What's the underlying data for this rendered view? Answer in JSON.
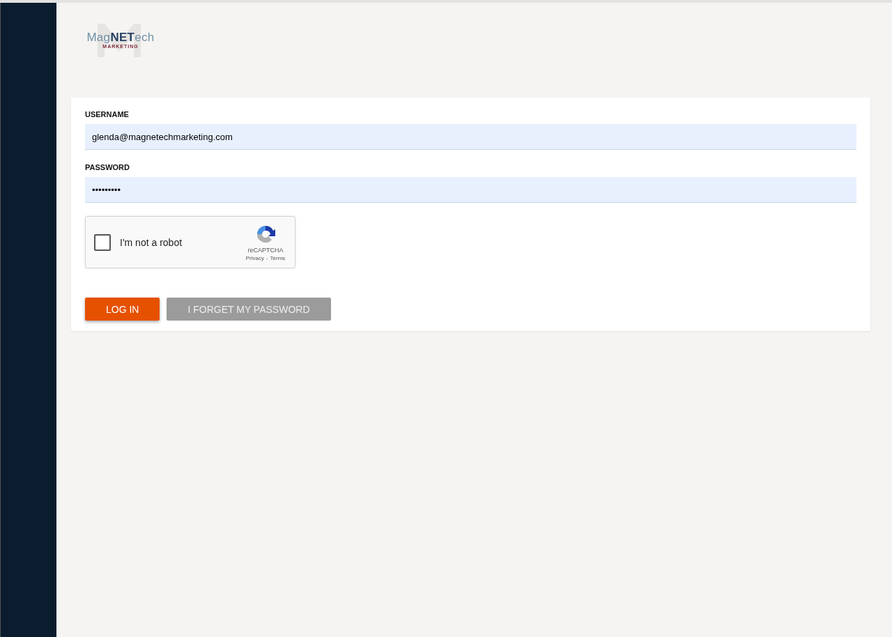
{
  "logo": {
    "name": "Mag**NET**ech",
    "tagline": "MARKETING"
  },
  "form": {
    "fields": [
      {
        "label": "USERNAME",
        "value": "glenda@magnetechmarketing.com"
      },
      {
        "label": "PASSWORD",
        "value": "•••••••••"
      }
    ],
    "captcha": {
      "label": "I'm not a robot",
      "checked": false,
      "brand": "reCAPTCHA",
      "privacy": "Privacy",
      "separator": "-",
      "terms": "Terms"
    },
    "buttons": [
      {
        "label": "LOG IN",
        "kind": "primary"
      },
      {
        "label": "I FORGET MY PASSWORD",
        "kind": "secondary"
      }
    ]
  }
}
